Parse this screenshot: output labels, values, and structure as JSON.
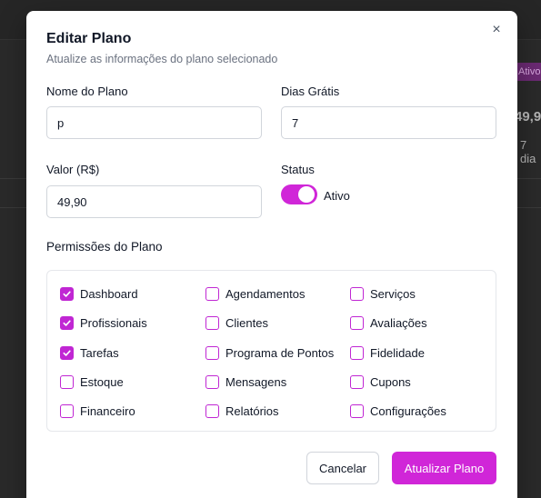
{
  "background": {
    "badge": "Ativo",
    "price": "49,9",
    "days": "7 dia"
  },
  "modal": {
    "title": "Editar Plano",
    "subtitle": "Atualize as informações do plano selecionado",
    "close_icon": "close-icon"
  },
  "form": {
    "name_label": "Nome do Plano",
    "name_value": "p",
    "trial_label": "Dias Grátis",
    "trial_value": "7",
    "price_label": "Valor (R$)",
    "price_value": "49,90",
    "status_label": "Status",
    "status_value": "Ativo",
    "status_on": true
  },
  "permissions": {
    "title": "Permissões do Plano",
    "items": [
      {
        "label": "Dashboard",
        "checked": true
      },
      {
        "label": "Agendamentos",
        "checked": false
      },
      {
        "label": "Serviços",
        "checked": false
      },
      {
        "label": "Profissionais",
        "checked": true
      },
      {
        "label": "Clientes",
        "checked": false
      },
      {
        "label": "Avaliações",
        "checked": false
      },
      {
        "label": "Tarefas",
        "checked": true
      },
      {
        "label": "Programa de Pontos",
        "checked": false
      },
      {
        "label": "Fidelidade",
        "checked": false
      },
      {
        "label": "Estoque",
        "checked": false
      },
      {
        "label": "Mensagens",
        "checked": false
      },
      {
        "label": "Cupons",
        "checked": false
      },
      {
        "label": "Financeiro",
        "checked": false
      },
      {
        "label": "Relatórios",
        "checked": false
      },
      {
        "label": "Configurações",
        "checked": false
      }
    ]
  },
  "actions": {
    "cancel_label": "Cancelar",
    "submit_label": "Atualizar Plano"
  },
  "colors": {
    "accent": "#d026d8",
    "checkbox": "#c026d3"
  }
}
